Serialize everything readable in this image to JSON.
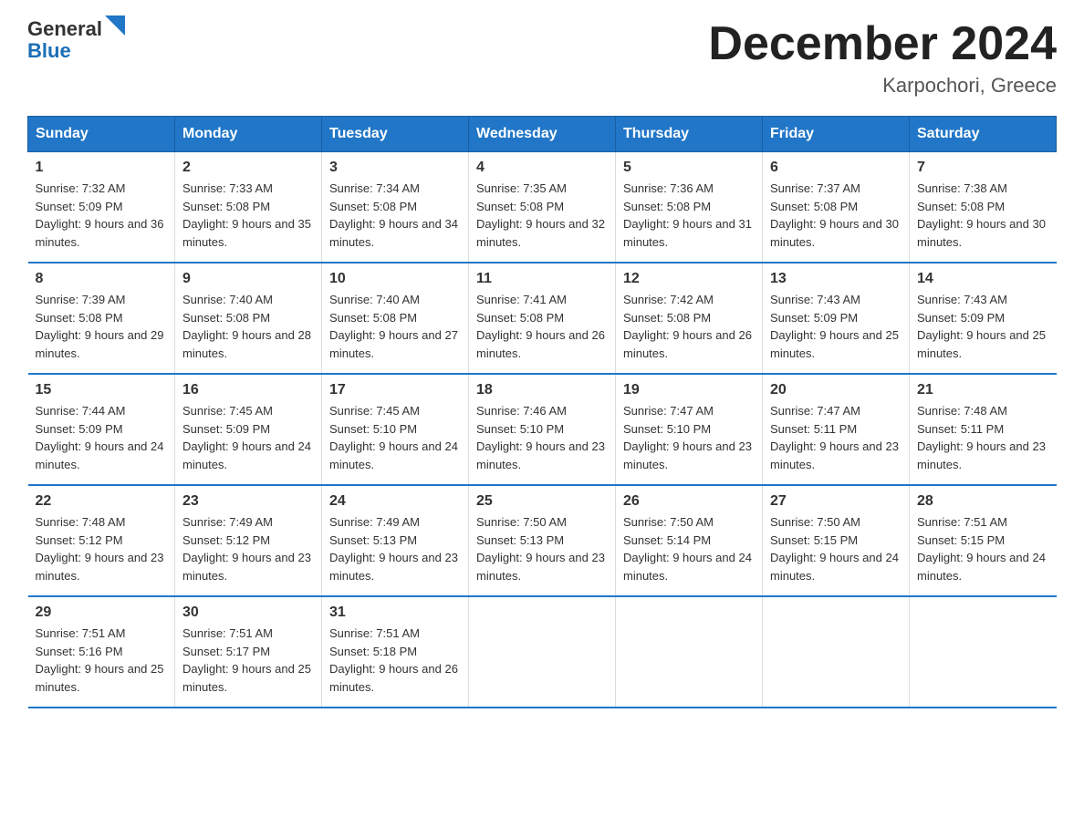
{
  "logo": {
    "text_general": "General",
    "text_blue": "Blue"
  },
  "header": {
    "title": "December 2024",
    "location": "Karpochori, Greece"
  },
  "days_of_week": [
    "Sunday",
    "Monday",
    "Tuesday",
    "Wednesday",
    "Thursday",
    "Friday",
    "Saturday"
  ],
  "weeks": [
    [
      {
        "day": "1",
        "sunrise": "7:32 AM",
        "sunset": "5:09 PM",
        "daylight": "9 hours and 36 minutes."
      },
      {
        "day": "2",
        "sunrise": "7:33 AM",
        "sunset": "5:08 PM",
        "daylight": "9 hours and 35 minutes."
      },
      {
        "day": "3",
        "sunrise": "7:34 AM",
        "sunset": "5:08 PM",
        "daylight": "9 hours and 34 minutes."
      },
      {
        "day": "4",
        "sunrise": "7:35 AM",
        "sunset": "5:08 PM",
        "daylight": "9 hours and 32 minutes."
      },
      {
        "day": "5",
        "sunrise": "7:36 AM",
        "sunset": "5:08 PM",
        "daylight": "9 hours and 31 minutes."
      },
      {
        "day": "6",
        "sunrise": "7:37 AM",
        "sunset": "5:08 PM",
        "daylight": "9 hours and 30 minutes."
      },
      {
        "day": "7",
        "sunrise": "7:38 AM",
        "sunset": "5:08 PM",
        "daylight": "9 hours and 30 minutes."
      }
    ],
    [
      {
        "day": "8",
        "sunrise": "7:39 AM",
        "sunset": "5:08 PM",
        "daylight": "9 hours and 29 minutes."
      },
      {
        "day": "9",
        "sunrise": "7:40 AM",
        "sunset": "5:08 PM",
        "daylight": "9 hours and 28 minutes."
      },
      {
        "day": "10",
        "sunrise": "7:40 AM",
        "sunset": "5:08 PM",
        "daylight": "9 hours and 27 minutes."
      },
      {
        "day": "11",
        "sunrise": "7:41 AM",
        "sunset": "5:08 PM",
        "daylight": "9 hours and 26 minutes."
      },
      {
        "day": "12",
        "sunrise": "7:42 AM",
        "sunset": "5:08 PM",
        "daylight": "9 hours and 26 minutes."
      },
      {
        "day": "13",
        "sunrise": "7:43 AM",
        "sunset": "5:09 PM",
        "daylight": "9 hours and 25 minutes."
      },
      {
        "day": "14",
        "sunrise": "7:43 AM",
        "sunset": "5:09 PM",
        "daylight": "9 hours and 25 minutes."
      }
    ],
    [
      {
        "day": "15",
        "sunrise": "7:44 AM",
        "sunset": "5:09 PM",
        "daylight": "9 hours and 24 minutes."
      },
      {
        "day": "16",
        "sunrise": "7:45 AM",
        "sunset": "5:09 PM",
        "daylight": "9 hours and 24 minutes."
      },
      {
        "day": "17",
        "sunrise": "7:45 AM",
        "sunset": "5:10 PM",
        "daylight": "9 hours and 24 minutes."
      },
      {
        "day": "18",
        "sunrise": "7:46 AM",
        "sunset": "5:10 PM",
        "daylight": "9 hours and 23 minutes."
      },
      {
        "day": "19",
        "sunrise": "7:47 AM",
        "sunset": "5:10 PM",
        "daylight": "9 hours and 23 minutes."
      },
      {
        "day": "20",
        "sunrise": "7:47 AM",
        "sunset": "5:11 PM",
        "daylight": "9 hours and 23 minutes."
      },
      {
        "day": "21",
        "sunrise": "7:48 AM",
        "sunset": "5:11 PM",
        "daylight": "9 hours and 23 minutes."
      }
    ],
    [
      {
        "day": "22",
        "sunrise": "7:48 AM",
        "sunset": "5:12 PM",
        "daylight": "9 hours and 23 minutes."
      },
      {
        "day": "23",
        "sunrise": "7:49 AM",
        "sunset": "5:12 PM",
        "daylight": "9 hours and 23 minutes."
      },
      {
        "day": "24",
        "sunrise": "7:49 AM",
        "sunset": "5:13 PM",
        "daylight": "9 hours and 23 minutes."
      },
      {
        "day": "25",
        "sunrise": "7:50 AM",
        "sunset": "5:13 PM",
        "daylight": "9 hours and 23 minutes."
      },
      {
        "day": "26",
        "sunrise": "7:50 AM",
        "sunset": "5:14 PM",
        "daylight": "9 hours and 24 minutes."
      },
      {
        "day": "27",
        "sunrise": "7:50 AM",
        "sunset": "5:15 PM",
        "daylight": "9 hours and 24 minutes."
      },
      {
        "day": "28",
        "sunrise": "7:51 AM",
        "sunset": "5:15 PM",
        "daylight": "9 hours and 24 minutes."
      }
    ],
    [
      {
        "day": "29",
        "sunrise": "7:51 AM",
        "sunset": "5:16 PM",
        "daylight": "9 hours and 25 minutes."
      },
      {
        "day": "30",
        "sunrise": "7:51 AM",
        "sunset": "5:17 PM",
        "daylight": "9 hours and 25 minutes."
      },
      {
        "day": "31",
        "sunrise": "7:51 AM",
        "sunset": "5:18 PM",
        "daylight": "9 hours and 26 minutes."
      },
      null,
      null,
      null,
      null
    ]
  ]
}
